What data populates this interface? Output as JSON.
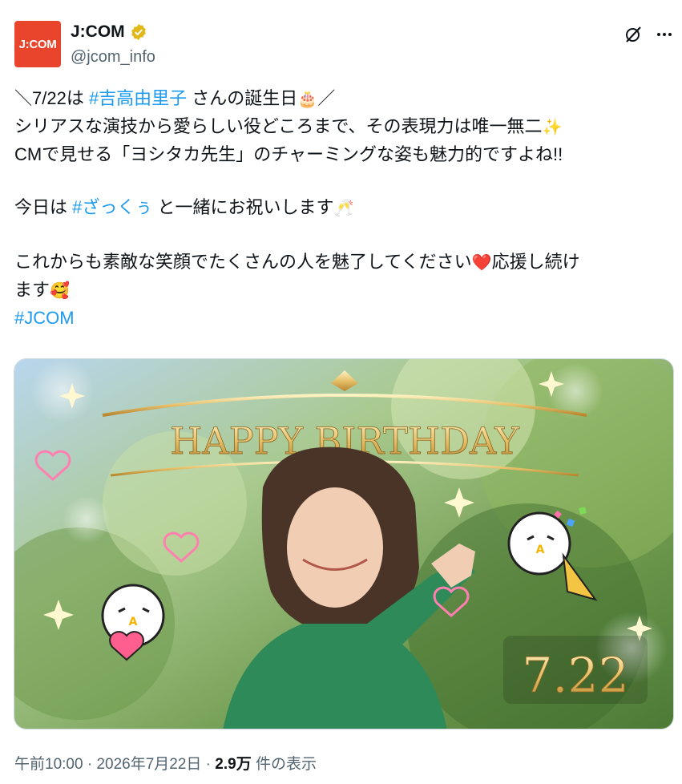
{
  "author": {
    "avatar_text": "J:COM",
    "display_name": "J:COM",
    "handle": "@jcom_info",
    "verified": true,
    "brand_color": "#e8452c"
  },
  "actions": {
    "grok_icon": "grok-slash-icon",
    "more_icon": "more-dots-icon"
  },
  "tweet": {
    "line1_pre": "＼7/22は ",
    "line1_tag": "#吉高由里子",
    "line1_post": " さんの誕生日",
    "line1_emoji": "🎂",
    "line1_end": "／",
    "line2": "シリアスな演技から愛らしい役どころまで、その表現力は唯一無二",
    "line2_emoji": "✨",
    "line3": "CMで見せる「ヨシタカ先生」のチャーミングな姿も魅力的ですよね!!",
    "line5_pre": "今日は ",
    "line5_tag": "#ざっくぅ",
    "line5_post": " と一緒にお祝いします",
    "line5_emoji": "🥂",
    "line7": "これからも素敵な笑顔でたくさんの人を魅了してください",
    "line7_emoji": "❤️",
    "line7_post": "応援し続け",
    "line8": "ます",
    "line8_emoji": "🥰",
    "line9_tag": "#JCOM",
    "hashtag_color": "#1d9bf0"
  },
  "media": {
    "banner_text": "HAPPY BIRTHDAY",
    "date_text": "7.22"
  },
  "meta": {
    "time": "午前10:00",
    "sep1": " · ",
    "date": "2026年7月22日",
    "sep2": " · ",
    "views_count": "2.9万",
    "views_label": " 件の表示"
  }
}
